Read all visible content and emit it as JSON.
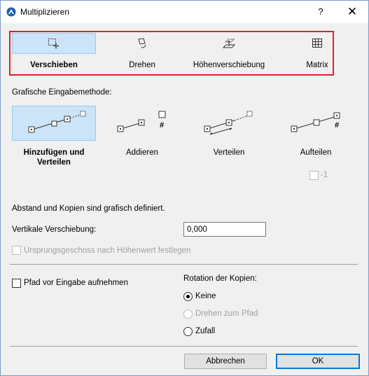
{
  "window": {
    "title": "Multiplizieren",
    "help": "?",
    "close": "✕"
  },
  "modes": [
    {
      "label": "Verschieben",
      "icon": "move-icon",
      "selected": true
    },
    {
      "label": "Drehen",
      "icon": "rotate-icon",
      "selected": false
    },
    {
      "label": "Höhenverschiebung",
      "icon": "elevate-icon",
      "selected": false
    },
    {
      "label": "Matrix",
      "icon": "matrix-icon",
      "selected": false
    }
  ],
  "input_method": {
    "heading": "Grafische Eingabemethode:",
    "methods": [
      {
        "label": "Hinzufügen und Verteilen",
        "selected": true
      },
      {
        "label": "Addieren",
        "selected": false,
        "hash": "#"
      },
      {
        "label": "Verteilen",
        "selected": false
      },
      {
        "label": "Aufteilen",
        "selected": false,
        "hash": "#"
      }
    ],
    "minus_one": "-1"
  },
  "info_text": "Abstand und Kopien sind grafisch definiert.",
  "vertical": {
    "label": "Vertikale Verschiebung:",
    "value": "0,000"
  },
  "origin_checkbox": {
    "label": "Ursprungsgeschoss nach Höhenwert festlegen",
    "checked": false,
    "enabled": false
  },
  "path_checkbox": {
    "label": "Pfad vor Eingabe aufnehmen",
    "checked": false
  },
  "rotation": {
    "heading": "Rotation der Kopien:",
    "options": [
      {
        "label": "Keine",
        "selected": true,
        "enabled": true
      },
      {
        "label": "Drehen zum Pfad",
        "selected": false,
        "enabled": false
      },
      {
        "label": "Zufall",
        "selected": false,
        "enabled": true
      }
    ]
  },
  "buttons": {
    "cancel": "Abbrechen",
    "ok": "OK"
  },
  "colors": {
    "selection": "#cce4f7",
    "highlight_border": "#e0202a",
    "default_button": "#0078d7"
  }
}
